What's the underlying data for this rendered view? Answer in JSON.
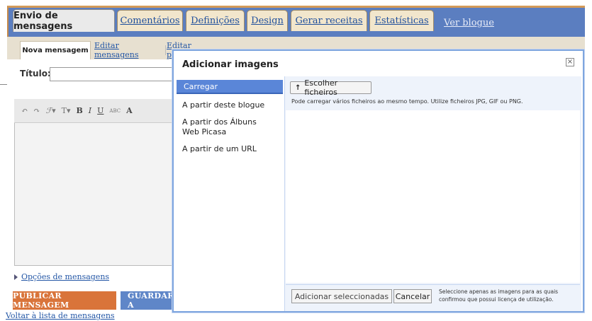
{
  "tabs": {
    "active": "Envio de mensagens",
    "items": [
      "Comentários",
      "Definições",
      "Design",
      "Gerar receitas",
      "Estatísticas"
    ],
    "view_blog": "Ver blogue"
  },
  "subtabs": {
    "active": "Nova mensagem",
    "edit": "Editar mensagens",
    "edit_pages": "Editar páginas"
  },
  "editor": {
    "title_label": "Título:",
    "options_link": "Opções de mensagens",
    "publish_button": "PUBLICAR MENSAGEM",
    "save_button": "GUARDAR A",
    "back_link": "Voltar à lista de mensagens"
  },
  "modal": {
    "title": "Adicionar imagens",
    "close_symbol": "×",
    "nav": {
      "active": "Carregar",
      "items": [
        "A partir deste blogue",
        "A partir dos Álbuns Web Picasa",
        "A partir de um URL"
      ]
    },
    "choose_button": "Escolher ficheiros",
    "upload_note": "Pode carregar vários ficheiros ao mesmo tempo. Utilize ficheiros JPG, GIF ou PNG.",
    "add_selected_button": "Adicionar seleccionadas",
    "cancel_button": "Cancelar",
    "license_note": "Seleccione apenas as imagens para as quais confirmou que possui licença de utilização."
  },
  "colors": {
    "tabbar_blue": "#5b7ec0",
    "accent_orange": "#d9743a",
    "save_blue": "#5f86c8",
    "nav_active": "#5a86d8"
  },
  "icons": {
    "choose_icon": "upload-arrow-icon",
    "close_icon": "close-icon",
    "options_icon": "triangle-right-icon"
  }
}
